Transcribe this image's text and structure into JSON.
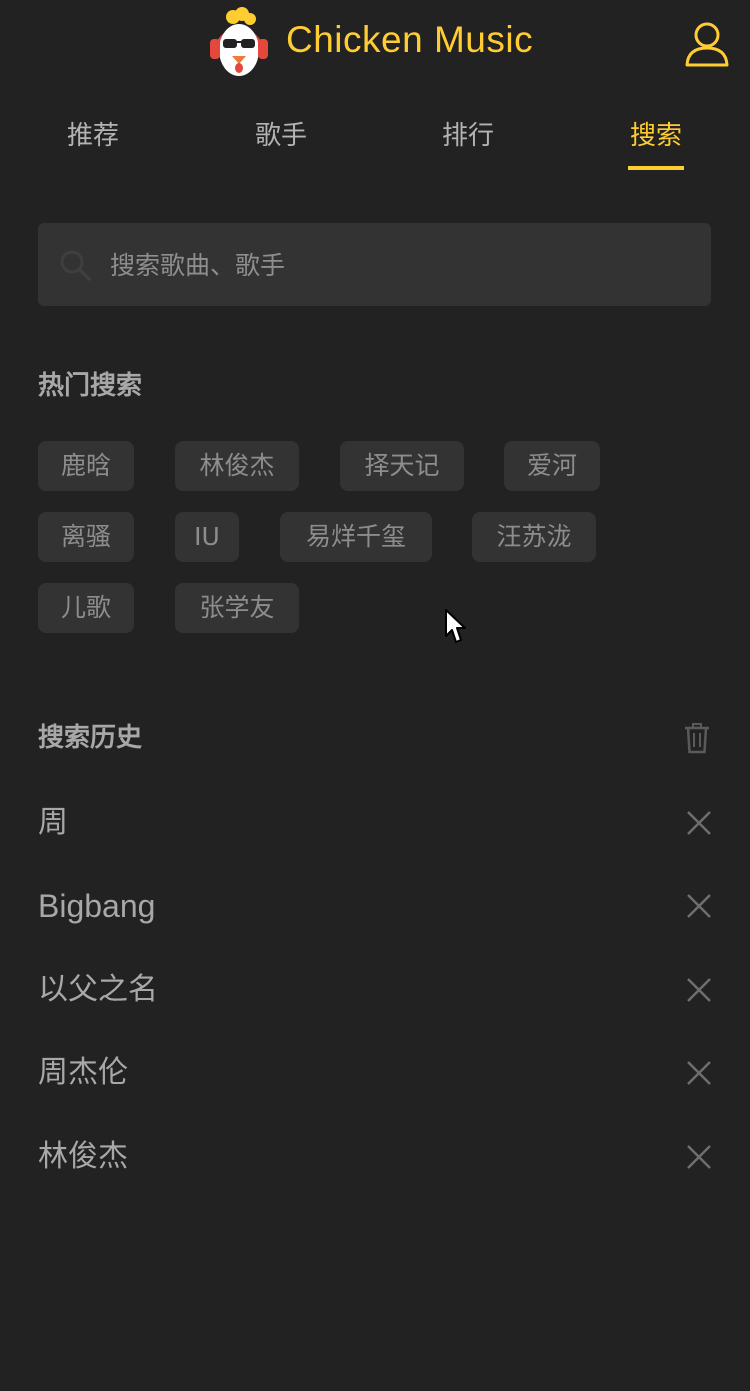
{
  "header": {
    "title": "Chicken Music",
    "logo_icon": "chicken-logo",
    "user_icon": "user-icon",
    "accent": "#ffcd32"
  },
  "tabs": [
    {
      "label": "推荐",
      "active": false
    },
    {
      "label": "歌手",
      "active": false
    },
    {
      "label": "排行",
      "active": false
    },
    {
      "label": "搜索",
      "active": true
    }
  ],
  "search": {
    "placeholder": "搜索歌曲、歌手",
    "value": ""
  },
  "hot": {
    "title": "热门搜索",
    "tags": [
      "鹿晗",
      "林俊杰",
      "择天记",
      "爱河",
      "离骚",
      "IU",
      "易烊千玺",
      "汪苏泷",
      "儿歌",
      "张学友"
    ]
  },
  "history": {
    "title": "搜索历史",
    "items": [
      "周",
      "Bigbang",
      "以父之名",
      "周杰伦",
      "林俊杰"
    ]
  },
  "colors": {
    "background": "#222222",
    "surface": "#333333",
    "accent": "#ffcd32"
  }
}
